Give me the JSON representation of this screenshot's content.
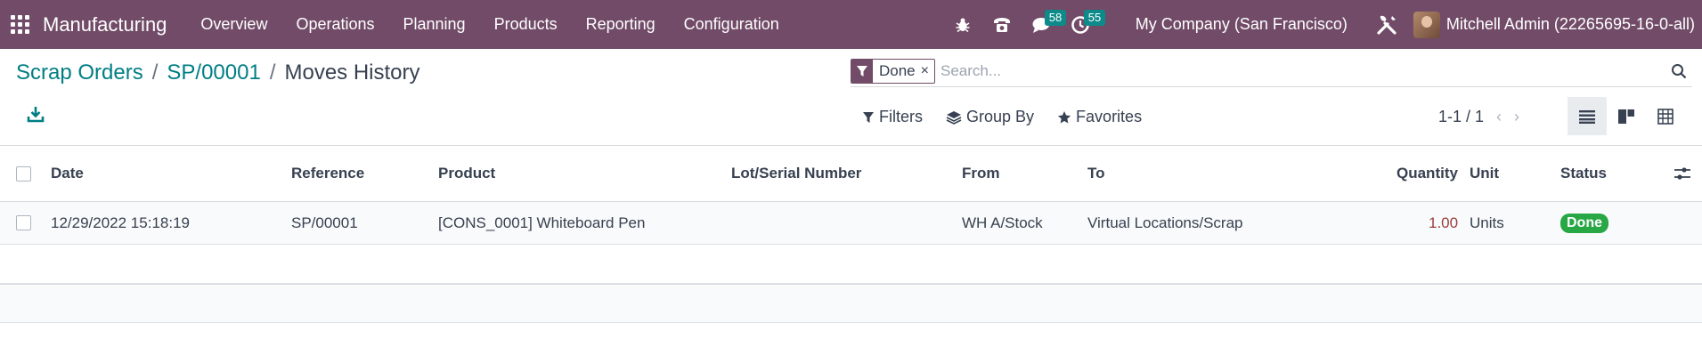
{
  "navbar": {
    "app_name": "Manufacturing",
    "menu": [
      "Overview",
      "Operations",
      "Planning",
      "Products",
      "Reporting",
      "Configuration"
    ],
    "messages_count": "58",
    "activities_count": "55",
    "company": "My Company (San Francisco)",
    "user": "Mitchell Admin (22265695-16-0-all)"
  },
  "breadcrumb": {
    "items": [
      "Scrap Orders",
      "SP/00001"
    ],
    "current": "Moves History",
    "separator": "/"
  },
  "search": {
    "facet_value": "Done",
    "facet_remove": "×",
    "placeholder": "Search..."
  },
  "toolbar": {
    "filters": "Filters",
    "group_by": "Group By",
    "favorites": "Favorites"
  },
  "pager": {
    "value": "1-1 / 1",
    "prev": "‹",
    "next": "›"
  },
  "table": {
    "columns": [
      "Date",
      "Reference",
      "Product",
      "Lot/Serial Number",
      "From",
      "To",
      "Quantity",
      "Unit",
      "Status"
    ],
    "rows": [
      {
        "date": "12/29/2022 15:18:19",
        "reference": "SP/00001",
        "product": "[CONS_0001] Whiteboard Pen",
        "lot": "",
        "from": "WH A/Stock",
        "to": "Virtual Locations/Scrap",
        "quantity": "1.00",
        "unit": "Units",
        "status": "Done"
      }
    ]
  },
  "colors": {
    "brand": "#714b67",
    "link": "#017e84",
    "badge": "#0d8a8a",
    "status_done": "#28a745",
    "quantity": "#9c3c3c"
  }
}
